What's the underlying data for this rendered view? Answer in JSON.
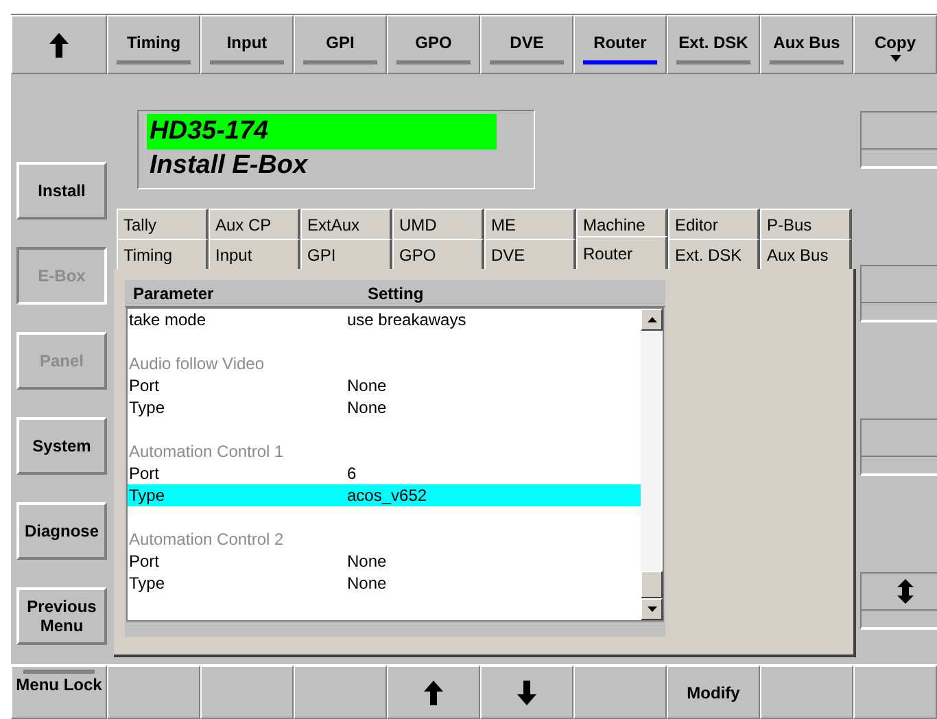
{
  "top_bar": [
    {
      "kind": "arrow_up"
    },
    {
      "kind": "tab",
      "label": "Timing",
      "selected": false
    },
    {
      "kind": "tab",
      "label": "Input",
      "selected": false
    },
    {
      "kind": "tab",
      "label": "GPI",
      "selected": false
    },
    {
      "kind": "tab",
      "label": "GPO",
      "selected": false
    },
    {
      "kind": "tab",
      "label": "DVE",
      "selected": false
    },
    {
      "kind": "tab",
      "label": "Router",
      "selected": true
    },
    {
      "kind": "tab",
      "label": "Ext. DSK",
      "selected": false
    },
    {
      "kind": "tab",
      "label": "Aux Bus",
      "selected": false
    },
    {
      "kind": "dropdown",
      "label": "Copy"
    }
  ],
  "side_menu": [
    {
      "label": "Install",
      "disabled": false,
      "selected": false
    },
    {
      "label": "E-Box",
      "disabled": true,
      "selected": true
    },
    {
      "label": "Panel",
      "disabled": true,
      "selected": false
    },
    {
      "label": "System",
      "disabled": false,
      "selected": false
    },
    {
      "label": "Diagnose",
      "disabled": false,
      "selected": false
    },
    {
      "label": "Previous Menu",
      "disabled": false,
      "selected": false
    }
  ],
  "title": {
    "device": "HD35-174",
    "subtitle": "Install E-Box"
  },
  "sub_tabs": [
    [
      {
        "label": "Tally",
        "selected": false
      },
      {
        "label": "Aux CP",
        "selected": false
      },
      {
        "label": "ExtAux",
        "selected": false
      },
      {
        "label": "UMD",
        "selected": false
      },
      {
        "label": "ME",
        "selected": false
      },
      {
        "label": "Machine",
        "selected": false
      },
      {
        "label": "Editor",
        "selected": false
      },
      {
        "label": "P-Bus",
        "selected": false
      }
    ],
    [
      {
        "label": "Timing",
        "selected": false
      },
      {
        "label": "Input",
        "selected": false
      },
      {
        "label": "GPI",
        "selected": false
      },
      {
        "label": "GPO",
        "selected": false
      },
      {
        "label": "DVE",
        "selected": false
      },
      {
        "label": "Router",
        "selected": true
      },
      {
        "label": "Ext. DSK",
        "selected": false
      },
      {
        "label": "Aux Bus",
        "selected": false
      }
    ]
  ],
  "table": {
    "columns": [
      "Parameter",
      "Setting"
    ],
    "rows": [
      {
        "kind": "setting",
        "parameter": "take mode",
        "setting": "use breakaways",
        "selected": false
      },
      {
        "kind": "blank"
      },
      {
        "kind": "group",
        "label": "Audio follow Video"
      },
      {
        "kind": "setting",
        "parameter": "Port",
        "setting": "None",
        "selected": false
      },
      {
        "kind": "setting",
        "parameter": "Type",
        "setting": "None",
        "selected": false
      },
      {
        "kind": "blank"
      },
      {
        "kind": "group",
        "label": "Automation Control 1"
      },
      {
        "kind": "setting",
        "parameter": "Port",
        "setting": "6",
        "selected": false
      },
      {
        "kind": "setting",
        "parameter": "Type",
        "setting": "acos_v652",
        "selected": true
      },
      {
        "kind": "blank"
      },
      {
        "kind": "group",
        "label": "Automation Control 2"
      },
      {
        "kind": "setting",
        "parameter": "Port",
        "setting": "None",
        "selected": false
      },
      {
        "kind": "setting",
        "parameter": "Type",
        "setting": "None",
        "selected": false
      }
    ]
  },
  "right_panel": [
    {
      "kind": "empty"
    },
    {
      "kind": "empty"
    },
    {
      "kind": "empty"
    },
    {
      "kind": "updown"
    }
  ],
  "bottom_bar": [
    {
      "kind": "lock",
      "label": "Menu Lock"
    },
    {
      "kind": "empty"
    },
    {
      "kind": "empty"
    },
    {
      "kind": "empty"
    },
    {
      "kind": "arrow_up"
    },
    {
      "kind": "arrow_down"
    },
    {
      "kind": "empty"
    },
    {
      "kind": "label",
      "label": "Modify"
    },
    {
      "kind": "empty"
    },
    {
      "kind": "empty"
    }
  ]
}
